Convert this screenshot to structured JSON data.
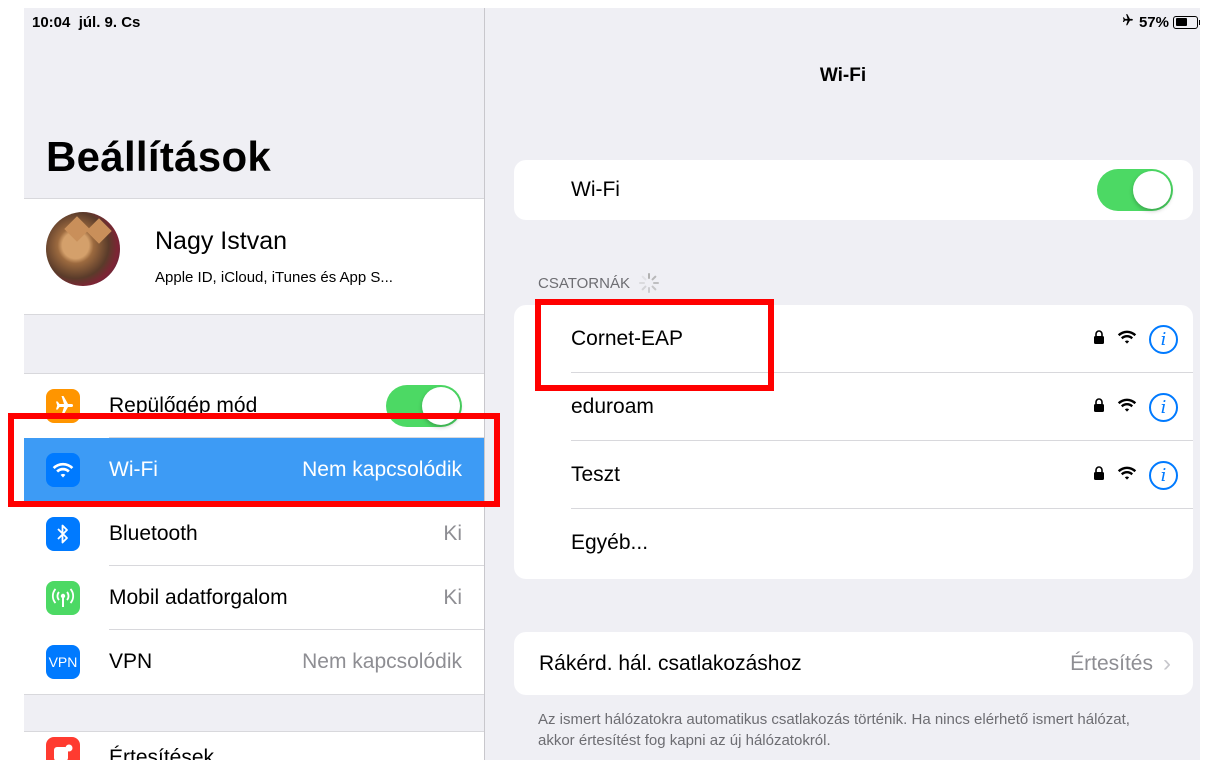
{
  "status": {
    "time": "10:04",
    "date": "júl. 9. Cs",
    "airplane_icon": "airplane-icon",
    "battery": "57%",
    "battery_level": 0.57
  },
  "left": {
    "title": "Beállítások",
    "profile": {
      "name": "Nagy Istvan",
      "subtitle": "Apple ID, iCloud, iTunes és App S..."
    },
    "rows": [
      {
        "label": "Repülőgép mód",
        "icon": "airplane-icon",
        "color": "#ff9500",
        "toggle": true
      },
      {
        "label": "Wi-Fi",
        "value": "Nem kapcsolódik",
        "icon": "wifi-icon",
        "color": "#007aff",
        "selected": true
      },
      {
        "label": "Bluetooth",
        "value": "Ki",
        "icon": "bluetooth-icon",
        "color": "#007aff"
      },
      {
        "label": "Mobil adatforgalom",
        "value": "Ki",
        "icon": "antenna-icon",
        "color": "#4cd964"
      },
      {
        "label": "VPN",
        "value": "Nem kapcsolódik",
        "icon": "vpn-icon",
        "icon_text": "VPN",
        "color": "#007aff"
      },
      {
        "label": "Értesítések",
        "icon": "notifications-icon",
        "color": "#ff3b30"
      }
    ]
  },
  "right": {
    "title": "Wi-Fi",
    "wifi_label": "Wi-Fi",
    "wifi_on": true,
    "section_header": "CSATORNÁK",
    "networks": [
      {
        "name": "Cornet-EAP",
        "locked": true
      },
      {
        "name": "eduroam",
        "locked": true
      },
      {
        "name": "Teszt",
        "locked": true
      }
    ],
    "other_label": "Egyéb...",
    "ask_label": "Rákérd. hál. csatlakozáshoz",
    "ask_value": "Értesítés",
    "footer": "Az ismert hálózatokra automatikus csatlakozás történik. Ha nincs elérhető ismert hálózat, akkor értesítést fog kapni az új hálózatokról."
  },
  "colors": {
    "accent": "#007aff",
    "toggle_on": "#4cd964",
    "selection": "#3d9bf5",
    "highlight": "#ff0000"
  }
}
